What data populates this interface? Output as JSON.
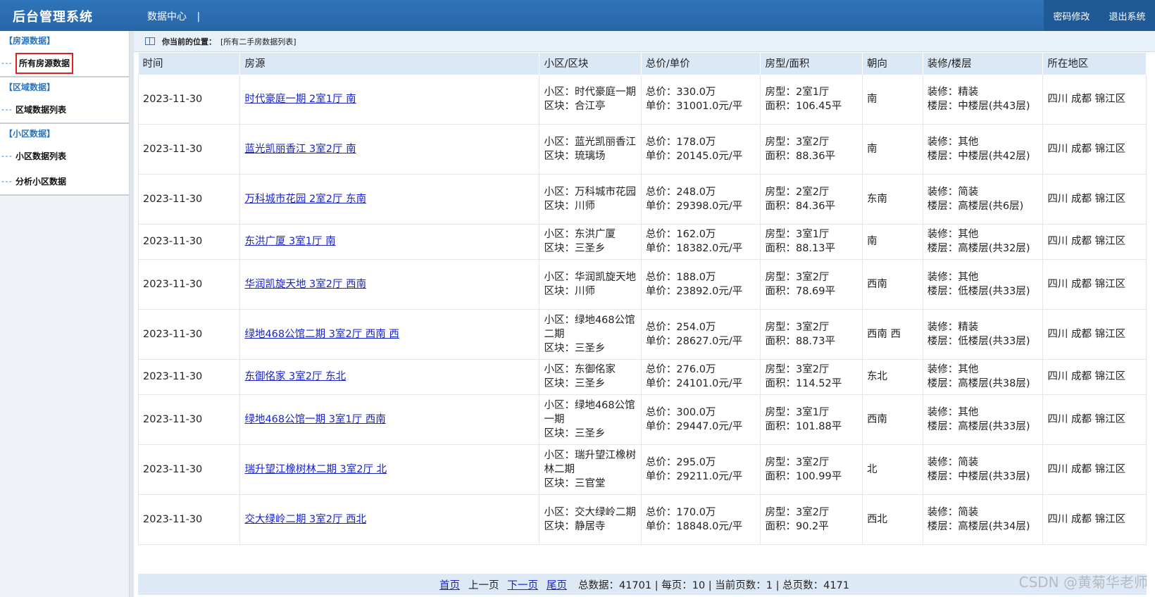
{
  "header": {
    "app_title": "后台管理系统",
    "nav_center": "数据中心",
    "nav_sep": "|",
    "change_password": "密码修改",
    "logout": "退出系统"
  },
  "sidebar": {
    "groups": [
      {
        "title": "【房源数据】",
        "items": [
          "所有房源数据"
        ]
      },
      {
        "title": "【区域数据】",
        "items": [
          "区域数据列表"
        ]
      },
      {
        "title": "【小区数据】",
        "items": [
          "小区数据列表",
          "分析小区数据"
        ]
      }
    ]
  },
  "breadcrumb": {
    "prefix": "你当前的位置：",
    "path": "[所有二手房数据列表]"
  },
  "table": {
    "headers": [
      "时间",
      "房源",
      "小区/区块",
      "总价/单价",
      "房型/面积",
      "朝向",
      "装修/楼层",
      "所在地区"
    ],
    "rows": [
      {
        "date": "2023-11-30",
        "title": "时代豪庭一期 2室1厅 南",
        "community": "小区：时代豪庭一期",
        "block": "区块：合江亭",
        "total": "总价：330.0万",
        "unit": "单价：31001.0元/平",
        "layout": "房型：2室1厅",
        "area": "面积：106.45平",
        "orientation": "南",
        "decor": "装修：精装",
        "floor": "楼层：中楼层(共43层)",
        "region": "四川 成都 锦江区"
      },
      {
        "date": "2023-11-30",
        "title": "蓝光凯丽香江 3室2厅 南",
        "community": "小区：蓝光凯丽香江",
        "block": "区块：琉璃场",
        "total": "总价：178.0万",
        "unit": "单价：20145.0元/平",
        "layout": "房型：3室2厅",
        "area": "面积：88.36平",
        "orientation": "南",
        "decor": "装修：其他",
        "floor": "楼层：中楼层(共42层)",
        "region": "四川 成都 锦江区"
      },
      {
        "date": "2023-11-30",
        "title": "万科城市花园 2室2厅 东南",
        "community": "小区：万科城市花园",
        "block": "区块：川师",
        "total": "总价：248.0万",
        "unit": "单价：29398.0元/平",
        "layout": "房型：2室2厅",
        "area": "面积：84.36平",
        "orientation": "东南",
        "decor": "装修：简装",
        "floor": "楼层：高楼层(共6层)",
        "region": "四川 成都 锦江区"
      },
      {
        "date": "2023-11-30",
        "title": "东洪广厦 3室1厅 南",
        "community": "小区：东洪广厦",
        "block": "区块：三圣乡",
        "total": "总价：162.0万",
        "unit": "单价：18382.0元/平",
        "layout": "房型：3室1厅",
        "area": "面积：88.13平",
        "orientation": "南",
        "decor": "装修：其他",
        "floor": "楼层：高楼层(共32层)",
        "region": "四川 成都 锦江区"
      },
      {
        "date": "2023-11-30",
        "title": "华润凯旋天地 3室2厅 西南",
        "community": "小区：华润凯旋天地",
        "block": "区块：川师",
        "total": "总价：188.0万",
        "unit": "单价：23892.0元/平",
        "layout": "房型：3室2厅",
        "area": "面积：78.69平",
        "orientation": "西南",
        "decor": "装修：其他",
        "floor": "楼层：低楼层(共33层)",
        "region": "四川 成都 锦江区"
      },
      {
        "date": "2023-11-30",
        "title": "绿地468公馆二期 3室2厅 西南 西",
        "community": "小区：绿地468公馆二期",
        "block": "区块：三圣乡",
        "total": "总价：254.0万",
        "unit": "单价：28627.0元/平",
        "layout": "房型：3室2厅",
        "area": "面积：88.73平",
        "orientation": "西南 西",
        "decor": "装修：精装",
        "floor": "楼层：低楼层(共33层)",
        "region": "四川 成都 锦江区"
      },
      {
        "date": "2023-11-30",
        "title": "东御佲家 3室2厅 东北",
        "community": "小区：东御佲家",
        "block": "区块：三圣乡",
        "total": "总价：276.0万",
        "unit": "单价：24101.0元/平",
        "layout": "房型：3室2厅",
        "area": "面积：114.52平",
        "orientation": "东北",
        "decor": "装修：其他",
        "floor": "楼层：高楼层(共38层)",
        "region": "四川 成都 锦江区"
      },
      {
        "date": "2023-11-30",
        "title": "绿地468公馆一期 3室1厅 西南",
        "community": "小区：绿地468公馆一期",
        "block": "区块：三圣乡",
        "total": "总价：300.0万",
        "unit": "单价：29447.0元/平",
        "layout": "房型：3室1厅",
        "area": "面积：101.88平",
        "orientation": "西南",
        "decor": "装修：其他",
        "floor": "楼层：高楼层(共33层)",
        "region": "四川 成都 锦江区"
      },
      {
        "date": "2023-11-30",
        "title": "瑞升望江橡树林二期 3室2厅 北",
        "community": "小区：瑞升望江橡树林二期",
        "block": "区块：三官堂",
        "total": "总价：295.0万",
        "unit": "单价：29211.0元/平",
        "layout": "房型：3室2厅",
        "area": "面积：100.99平",
        "orientation": "北",
        "decor": "装修：简装",
        "floor": "楼层：中楼层(共33层)",
        "region": "四川 成都 锦江区"
      },
      {
        "date": "2023-11-30",
        "title": "交大绿岭二期 3室2厅 西北",
        "community": "小区：交大绿岭二期",
        "block": "区块：静居寺",
        "total": "总价：170.0万",
        "unit": "单价：18848.0元/平",
        "layout": "房型：3室2厅",
        "area": "面积：90.2平",
        "orientation": "西北",
        "decor": "装修：简装",
        "floor": "楼层：高楼层(共34层)",
        "region": "四川 成都 锦江区"
      }
    ]
  },
  "pager": {
    "first": "首页",
    "prev": "上一页",
    "next": "下一页",
    "last": "尾页",
    "stats": "总数据：41701 | 每页：10 | 当前页数：1 | 总页数：4171"
  },
  "watermark": "CSDN @黄菊华老师"
}
